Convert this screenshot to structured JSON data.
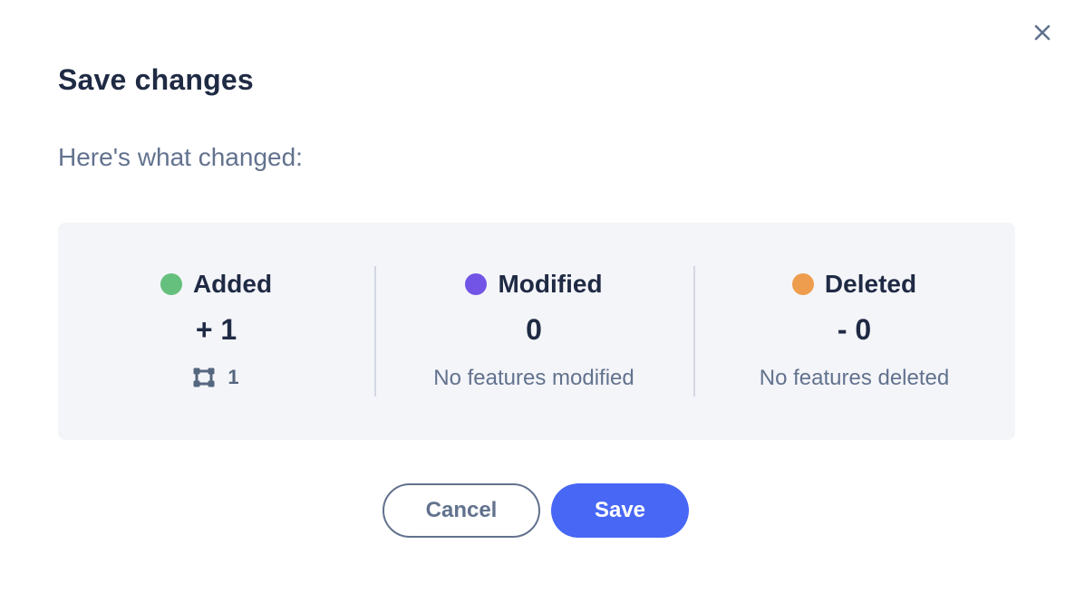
{
  "dialog": {
    "title": "Save changes",
    "subtitle": "Here's what changed:"
  },
  "summary": {
    "added": {
      "label": "Added",
      "value": "+ 1",
      "detail_icon": "polygon-icon",
      "detail_count": "1",
      "color": "#66c07d"
    },
    "modified": {
      "label": "Modified",
      "value": "0",
      "note": "No features modified",
      "color": "#7254e6"
    },
    "deleted": {
      "label": "Deleted",
      "value": "- 0",
      "note": "No features deleted",
      "color": "#ee9d4e"
    }
  },
  "actions": {
    "cancel_label": "Cancel",
    "save_label": "Save"
  },
  "colors": {
    "primary": "#4867f5",
    "text_dark": "#1f2a44",
    "text_muted": "#62728e",
    "panel_bg": "#f4f5f9"
  }
}
